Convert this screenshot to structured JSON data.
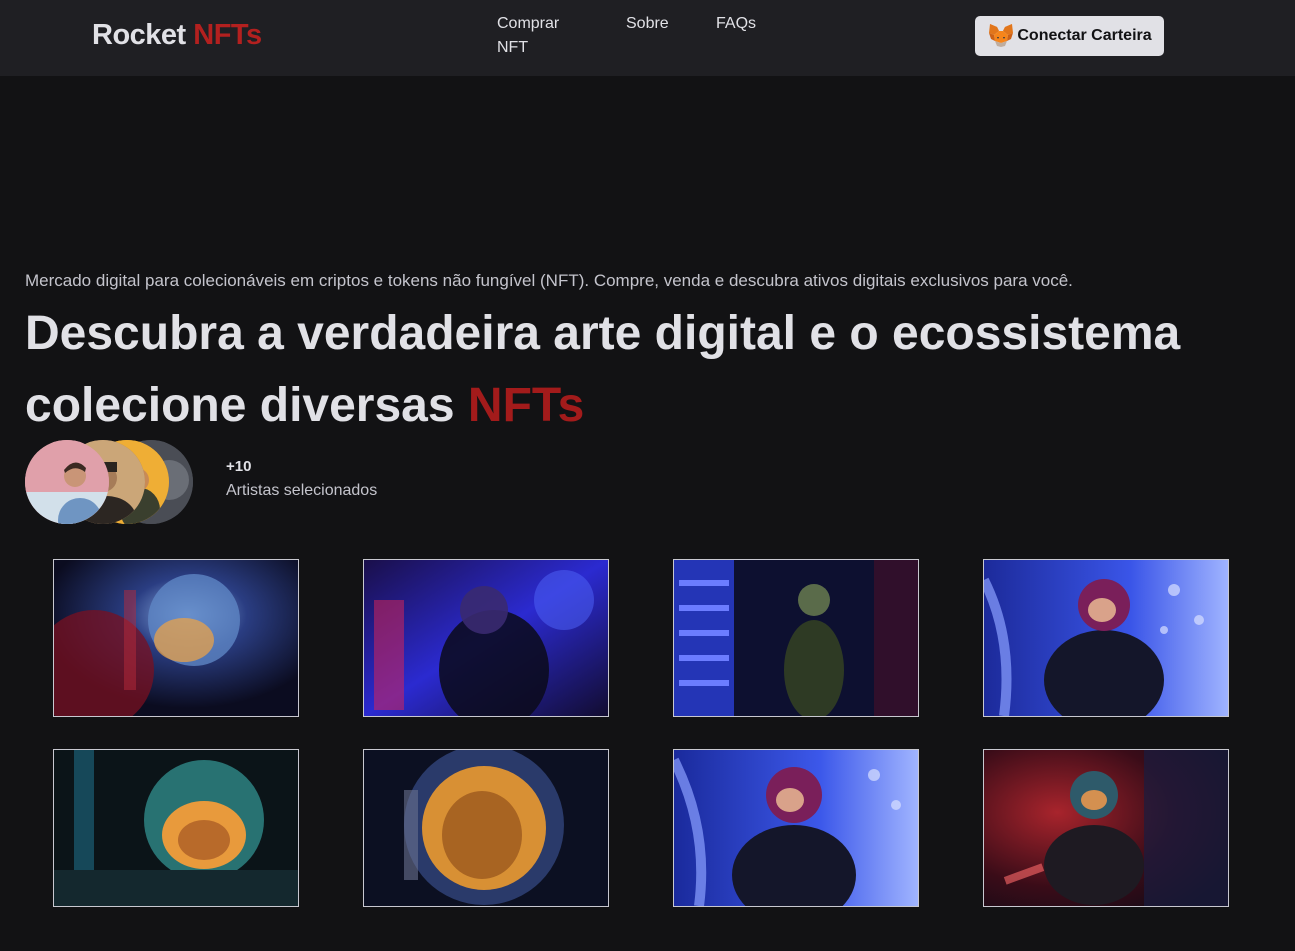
{
  "header": {
    "logo": {
      "main": "Rocket",
      "accent": "NFTs"
    },
    "nav": [
      {
        "label": "Comprar NFT"
      },
      {
        "label": "Sobre"
      },
      {
        "label": "FAQs"
      }
    ],
    "connect_button": {
      "label": "Conectar Carteira",
      "icon": "metamask-fox-icon"
    }
  },
  "hero": {
    "subtitle": "Mercado digital para colecionáveis em criptos e tokens não fungível (NFT). Compre, venda e descubra ativos digitais exclusivos para você.",
    "headline_main": "Descubra a verdadeira arte digital e o ecossistema colecione diversas ",
    "headline_accent": "NFTs",
    "artists": {
      "count": "+10",
      "label": "Artistas selecionados"
    }
  },
  "gallery": {
    "items": [
      {
        "name": "astronaut-red-blue"
      },
      {
        "name": "astronaut-blue-profile"
      },
      {
        "name": "astronaut-neon-ladder"
      },
      {
        "name": "astronaut-pink-helmet"
      },
      {
        "name": "astronaut-teal-helmet"
      },
      {
        "name": "astronaut-gold-visor"
      },
      {
        "name": "astronaut-pink-helmet-2"
      },
      {
        "name": "astronaut-red-sitting"
      }
    ]
  },
  "colors": {
    "background": "#121214",
    "header": "#1f1f23",
    "accent": "#b3201f",
    "text": "#e1e1e6"
  }
}
